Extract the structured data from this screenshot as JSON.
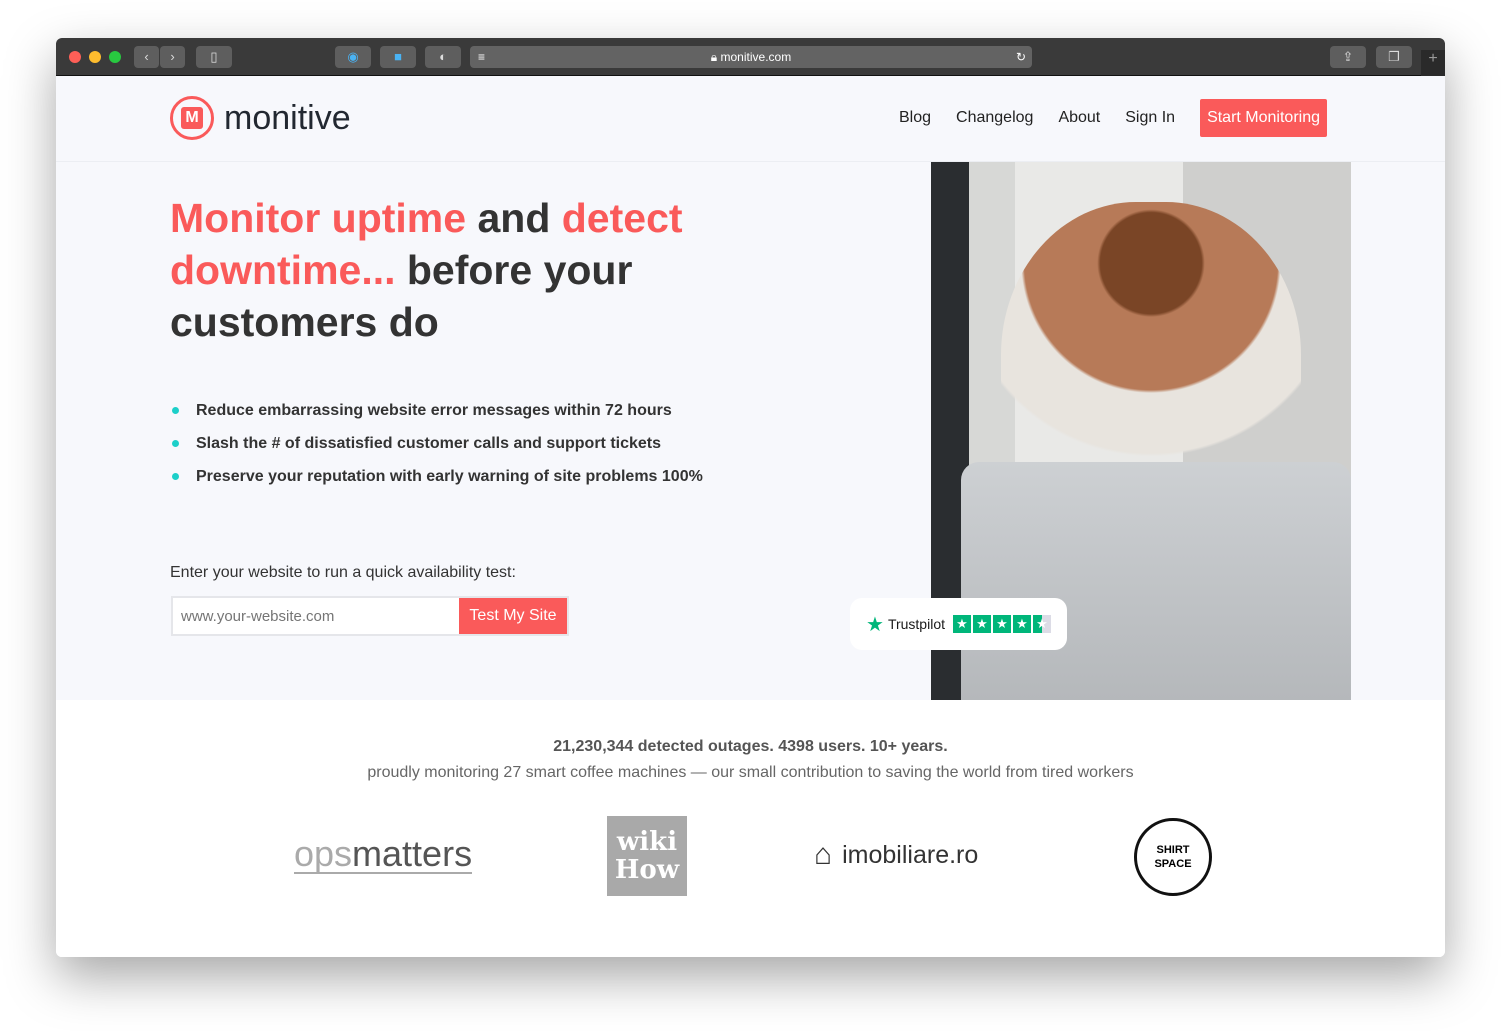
{
  "browser": {
    "url": "monitive.com",
    "icons": [
      "back-icon",
      "forward-icon",
      "sidebar-icon",
      "1password-icon",
      "bookmark-icon",
      "shield-icon",
      "reader-icon",
      "lock-icon",
      "reload-icon",
      "share-icon",
      "tabs-icon",
      "new-tab-icon"
    ]
  },
  "nav": {
    "brand": "monitive",
    "logo_letter": "M",
    "items": [
      "Blog",
      "Changelog",
      "About",
      "Sign In"
    ],
    "cta": "Start Monitoring"
  },
  "hero": {
    "h1_a": "Monitor uptime",
    "h1_b": " and ",
    "h1_c": "detect downtime...",
    "h1_d": " before your customers do",
    "bullets": [
      "Reduce embarrassing website error messages within 72 hours",
      "Slash the # of dissatisfied customer calls and support tickets",
      "Preserve your reputation with early warning of site problems 100%"
    ],
    "form_label": "Enter your website to run a quick availability test:",
    "placeholder": "www.your-website.com",
    "button": "Test My Site"
  },
  "trustpilot": {
    "name": "Trustpilot",
    "rating": 4.5,
    "max": 5
  },
  "stats": {
    "headline": "21,230,344 detected outages. 4398 users. 10+ years.",
    "sub": "proudly monitoring 27 smart coffee machines — our small contribution to saving the world from tired workers"
  },
  "logos": {
    "ops_a": "ops",
    "ops_b": "matters",
    "wiki_a": "wiki",
    "wiki_b": "How",
    "imob": "imobiliare.ro",
    "shirt": "SHIRT SPACE"
  },
  "colors": {
    "accent": "#fa5a5a",
    "bullet": "#1ccfc9",
    "trustpilot": "#00b67a"
  }
}
